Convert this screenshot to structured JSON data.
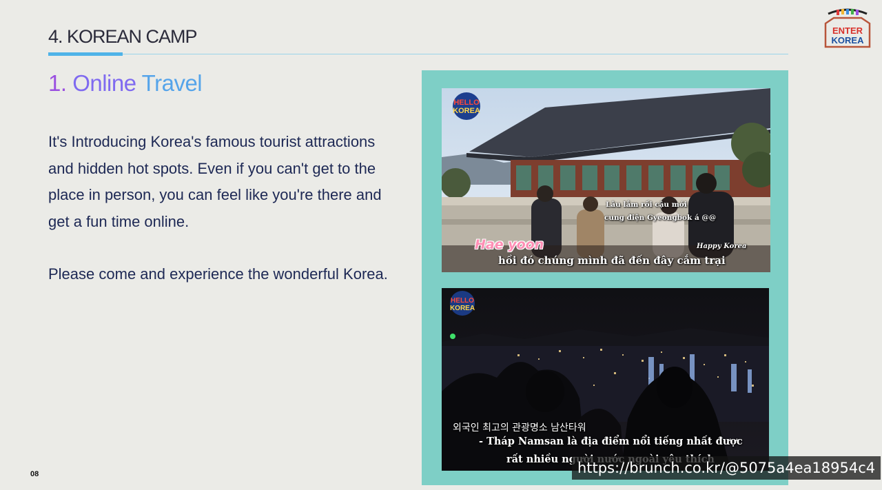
{
  "header": {
    "section_title": "4. KOREAN CAMP"
  },
  "logo": {
    "line1": "ENTER",
    "line2": "KOREA"
  },
  "content": {
    "subtitle_num": "1.",
    "subtitle_a": "Online",
    "subtitle_b": "Travel",
    "lines": [
      "It's Introducing Korea's famous tourist attractions",
      "and hidden hot spots. Even if you can't get to the",
      "place in person, you can feel like you're there and",
      "get a fun time online."
    ],
    "closing": "Please come and experience the wonderful Korea."
  },
  "photo1": {
    "badge_top": "HELLO",
    "badge_bottom": "KOREA",
    "bubble_1": "Lâu lắm rồi cậu mới",
    "bubble_2": "cung điện Gyeongbok á @@",
    "name_tag": "Hae yoon",
    "stamp": "Happy Korea",
    "subtitle": "hồi đó chúng mình đã đến đây cắm trại"
  },
  "photo2": {
    "badge_top": "HELLO",
    "badge_bottom": "KOREA",
    "korean_caption": "외국인 최고의 관광명소 남산타워",
    "sub_1": "-  Tháp Namsan là địa điểm nổi tiếng nhất được",
    "sub_2": "rất nhiều người nước ngoài yêu thích"
  },
  "footer": {
    "page_number": "08",
    "watermark": "https://brunch.co.kr/@5075a4ea18954c4"
  },
  "colors": {
    "background": "#ebebe7",
    "panel": "#7ecfc6",
    "accent_rule": "#4fb3e8",
    "body_text": "#1d2854"
  }
}
